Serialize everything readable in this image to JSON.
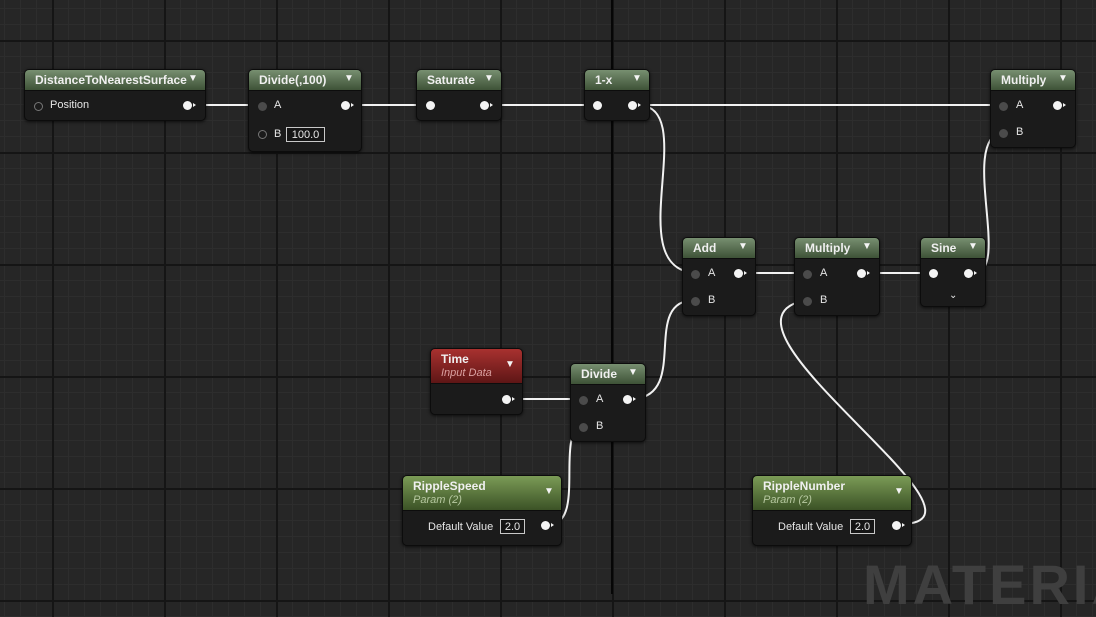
{
  "nodes": {
    "distance": {
      "title": "DistanceToNearestSurface",
      "input_label": "Position"
    },
    "divide100": {
      "title": "Divide(,100)",
      "input_a": "A",
      "input_b": "B",
      "b_value": "100.0"
    },
    "saturate": {
      "title": "Saturate"
    },
    "oneminus": {
      "title": "1-x"
    },
    "multiply_top": {
      "title": "Multiply",
      "input_a": "A",
      "input_b": "B"
    },
    "add": {
      "title": "Add",
      "input_a": "A",
      "input_b": "B"
    },
    "multiply_mid": {
      "title": "Multiply",
      "input_a": "A",
      "input_b": "B"
    },
    "sine": {
      "title": "Sine"
    },
    "time": {
      "title": "Time",
      "subtitle": "Input Data"
    },
    "divide": {
      "title": "Divide",
      "input_a": "A",
      "input_b": "B"
    },
    "ripple_speed": {
      "title": "RippleSpeed",
      "subtitle": "Param (2)",
      "field_label": "Default Value",
      "value": "2.0"
    },
    "ripple_number": {
      "title": "RippleNumber",
      "subtitle": "Param (2)",
      "field_label": "Default Value",
      "value": "2.0"
    }
  },
  "watermark": "MATERIA",
  "colors": {
    "background": "#262626",
    "wire": "#f2f2f2",
    "function_header": "#5c7355",
    "input_header": "#8b2422",
    "param_header": "#5e7d3e"
  }
}
